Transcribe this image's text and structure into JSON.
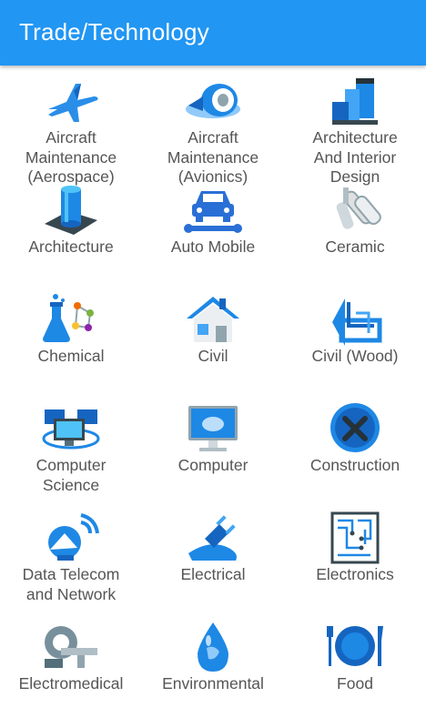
{
  "header": {
    "title": "Trade/Technology"
  },
  "colors": {
    "appbar": "#2196f3",
    "label": "#555555",
    "icon_blue": "#1e88e5"
  },
  "trades": [
    {
      "label": "Aircraft\nMaintenance\n(Aerospace)",
      "icon": "airplane-icon"
    },
    {
      "label": "Aircraft\nMaintenance\n(Avionics)",
      "icon": "jet-engine-icon"
    },
    {
      "label": "Architecture\nAnd Interior\nDesign",
      "icon": "building-blocks-icon"
    },
    {
      "label": "Architecture",
      "icon": "tower-icon"
    },
    {
      "label": "Auto Mobile",
      "icon": "car-wrench-icon"
    },
    {
      "label": "Ceramic",
      "icon": "ceramic-rollers-icon"
    },
    {
      "label": "Chemical",
      "icon": "flask-molecule-icon"
    },
    {
      "label": "Civil",
      "icon": "house-icon"
    },
    {
      "label": "Civil (Wood)",
      "icon": "drafting-tools-icon"
    },
    {
      "label": "Computer\nScience",
      "icon": "networked-computers-icon"
    },
    {
      "label": "Computer",
      "icon": "monitor-icon"
    },
    {
      "label": "Construction",
      "icon": "tools-circle-icon"
    },
    {
      "label": "Data Telecom\nand Network",
      "icon": "satellite-dish-icon"
    },
    {
      "label": "Electrical",
      "icon": "power-plug-icon"
    },
    {
      "label": "Electronics",
      "icon": "circuit-board-icon"
    },
    {
      "label": "Electromedical",
      "icon": "mri-scanner-icon"
    },
    {
      "label": "Environmental",
      "icon": "water-drop-globe-icon"
    },
    {
      "label": "Food",
      "icon": "plate-cutlery-icon"
    }
  ]
}
